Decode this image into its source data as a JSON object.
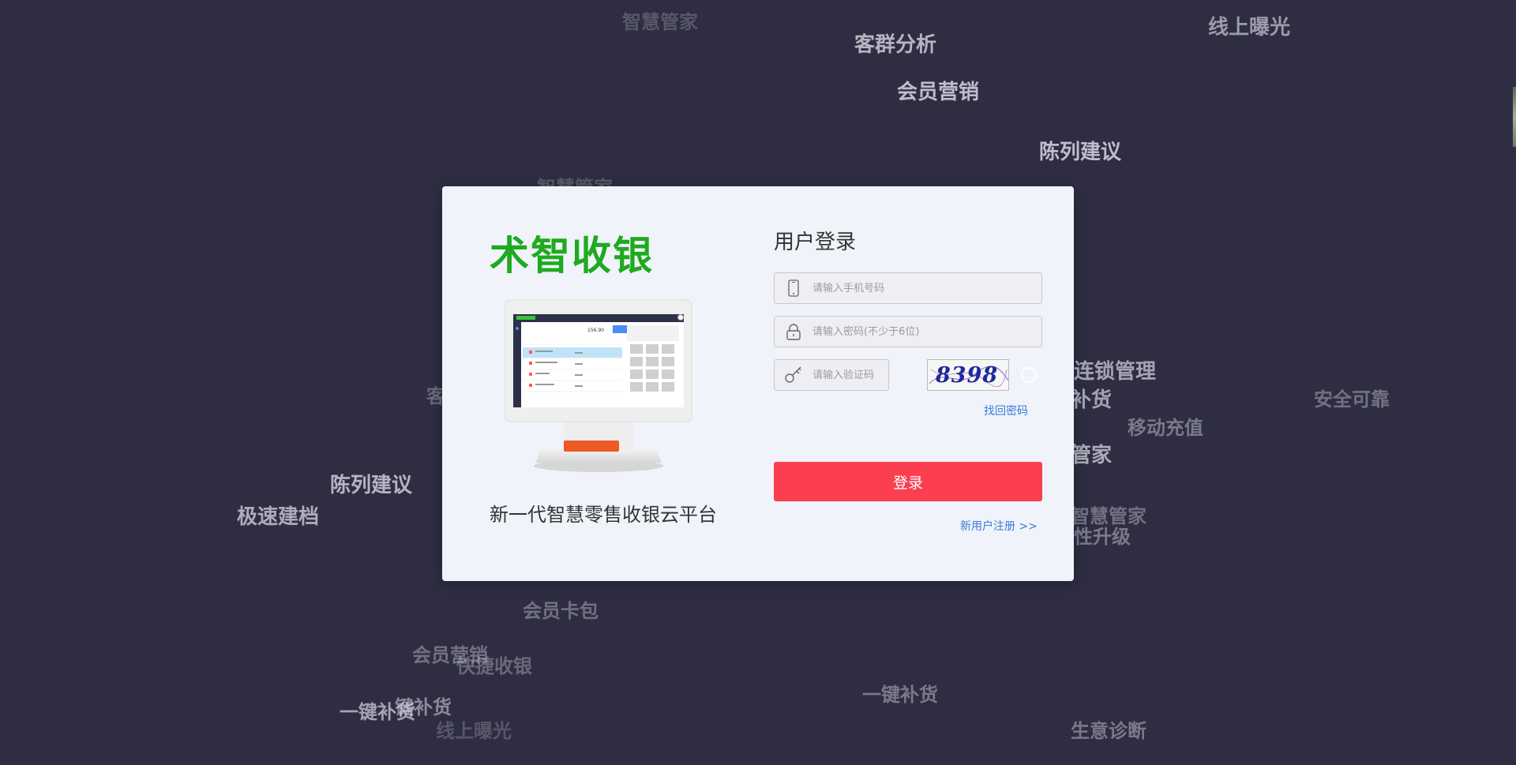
{
  "background_words": [
    {
      "text": "智慧管家",
      "size": 24,
      "opacity": 0.25
    },
    {
      "text": "客群分析",
      "size": 26,
      "opacity": 0.8
    },
    {
      "text": "线上曝光",
      "size": 26,
      "opacity": 0.65
    },
    {
      "text": "会员营销",
      "size": 26,
      "opacity": 0.85
    },
    {
      "text": "陈列建议",
      "size": 26,
      "opacity": 0.85
    },
    {
      "text": "智慧管家",
      "size": 24,
      "opacity": 0.25
    },
    {
      "text": "连锁管理",
      "size": 26,
      "opacity": 0.7
    },
    {
      "text": "补货",
      "size": 26,
      "opacity": 0.7
    },
    {
      "text": "安全可靠",
      "size": 24,
      "opacity": 0.4
    },
    {
      "text": "移动充值",
      "size": 24,
      "opacity": 0.45
    },
    {
      "text": "管家",
      "size": 26,
      "opacity": 0.75
    },
    {
      "text": "陈列建议",
      "size": 26,
      "opacity": 0.8
    },
    {
      "text": "极速建档",
      "size": 26,
      "opacity": 0.75
    },
    {
      "text": "客",
      "size": 24,
      "opacity": 0.35
    },
    {
      "text": "智慧管家",
      "size": 24,
      "opacity": 0.4
    },
    {
      "text": "性升级",
      "size": 24,
      "opacity": 0.45
    },
    {
      "text": "会员卡包",
      "size": 24,
      "opacity": 0.4
    },
    {
      "text": "会员营销",
      "size": 24,
      "opacity": 0.4
    },
    {
      "text": "快捷收银",
      "size": 24,
      "opacity": 0.35
    },
    {
      "text": "一键补货",
      "size": 24,
      "opacity": 0.7
    },
    {
      "text": "键补货",
      "size": 24,
      "opacity": 0.55
    },
    {
      "text": "线上曝光",
      "size": 24,
      "opacity": 0.25
    },
    {
      "text": "一键补货",
      "size": 24,
      "opacity": 0.45
    },
    {
      "text": "生意诊断",
      "size": 24,
      "opacity": 0.45
    }
  ],
  "brand": {
    "logo_text": "术智收银",
    "logo_color": "#1faa1f",
    "tagline": "新一代智慧零售收银云平台"
  },
  "device_screen": {
    "amount": "156.90"
  },
  "login": {
    "title": "用户登录",
    "phone": {
      "placeholder": "请输入手机号码",
      "icon": "phone-icon"
    },
    "password": {
      "placeholder": "请输入密码(不少于6位)",
      "icon": "lock-icon"
    },
    "captcha": {
      "placeholder": "请输入验证码",
      "icon": "key-icon",
      "code": "8398"
    },
    "forgot_password": "找回密码",
    "submit": "登录",
    "register": "新用户注册 >>"
  },
  "colors": {
    "background": "#2e2d42",
    "card": "#f0f3fa",
    "primary_button": "#fb3f51",
    "link": "#3a7bd5"
  }
}
